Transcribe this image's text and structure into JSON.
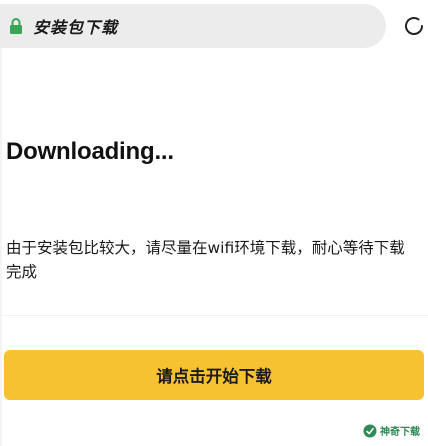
{
  "address_bar": {
    "url_text": "安装包下载",
    "lock_icon": "lock-icon",
    "refresh_icon": "refresh-icon",
    "lock_color": "#3aa655"
  },
  "main": {
    "heading": "Downloading...",
    "notice": "由于安装包比较大，请尽量在wifi环境下载，耐心等待下载完成",
    "start_button_label": "请点击开始下载",
    "accent_color": "#f7c232"
  },
  "watermark": {
    "text": "神奇下载",
    "logo": "watermark-logo-icon",
    "color": "#2e8b57"
  }
}
